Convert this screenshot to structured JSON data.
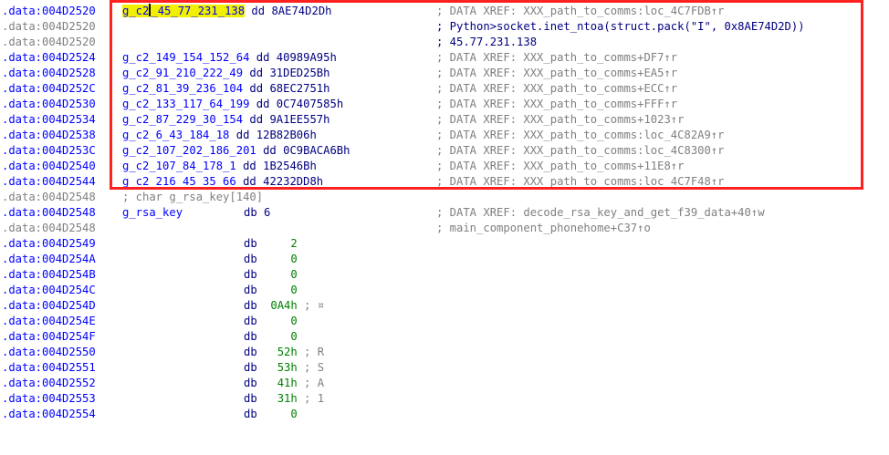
{
  "highlight_color": "#ff2020",
  "lines": [
    {
      "addr": ".data:004D2520",
      "name_hl": "g_c2",
      "name": "_45_77_231_138",
      "dir": "dd",
      "val": "8AE74D2Dh",
      "comment": "; DATA XREF: XXX_path_to_comms:loc_4C7FDB↑r"
    },
    {
      "addr": ".data:004D2520",
      "comment": "; Python>socket.inet_ntoa(struct.pack(\"I\", 0x8AE74D2D))"
    },
    {
      "addr": ".data:004D2520",
      "comment": "; 45.77.231.138"
    },
    {
      "addr": ".data:004D2524",
      "name": "g_c2_149_154_152_64",
      "dir": "dd",
      "val": "40989A95h",
      "comment": "; DATA XREF: XXX_path_to_comms+DF7↑r"
    },
    {
      "addr": ".data:004D2528",
      "name": "g_c2_91_210_222_49",
      "dir": "dd",
      "val": "31DED25Bh",
      "comment": "; DATA XREF: XXX_path_to_comms+EA5↑r"
    },
    {
      "addr": ".data:004D252C",
      "name": "g_c2_81_39_236_104",
      "dir": "dd",
      "val": "68EC2751h",
      "comment": "; DATA XREF: XXX_path_to_comms+ECC↑r"
    },
    {
      "addr": ".data:004D2530",
      "name": "g_c2_133_117_64_199",
      "dir": "dd",
      "val": "0C7407585h",
      "comment": "; DATA XREF: XXX_path_to_comms+FFF↑r"
    },
    {
      "addr": ".data:004D2534",
      "name": "g_c2_87_229_30_154",
      "dir": "dd",
      "val": "9A1EE557h",
      "comment": "; DATA XREF: XXX_path_to_comms+1023↑r"
    },
    {
      "addr": ".data:004D2538",
      "name": "g_c2_6_43_184_18",
      "dir": "dd",
      "val": "12B82B06h",
      "comment": "; DATA XREF: XXX_path_to_comms:loc_4C82A9↑r"
    },
    {
      "addr": ".data:004D253C",
      "name": "g_c2_107_202_186_201",
      "dir": "dd",
      "val": "0C9BACA6Bh",
      "comment": "; DATA XREF: XXX_path_to_comms:loc_4C8300↑r"
    },
    {
      "addr": ".data:004D2540",
      "name": "g_c2_107_84_178_1",
      "dir": "dd",
      "val": "1B2546Bh",
      "comment": "; DATA XREF: XXX_path_to_comms+11E8↑r"
    },
    {
      "addr": ".data:004D2544",
      "name": "g_c2_216_45_35_66",
      "dir": "dd",
      "val": "42232DD8h",
      "comment": "; DATA XREF: XXX_path_to_comms:loc_4C7F48↑r"
    },
    {
      "addr": ".data:004D2548",
      "struct": "; char g_rsa_key[140]"
    },
    {
      "addr": ".data:004D2548",
      "name": "g_rsa_key",
      "dir": "db",
      "val": "6",
      "comment": "; DATA XREF: decode_rsa_key_and_get_f39_data+40↑w"
    },
    {
      "addr": ".data:004D2548",
      "comment": "; main_component_phonehome+C37↑o"
    },
    {
      "addr": ".data:004D2549",
      "dir": "db",
      "val": "2"
    },
    {
      "addr": ".data:004D254A",
      "dir": "db",
      "val": "0"
    },
    {
      "addr": ".data:004D254B",
      "dir": "db",
      "val": "0"
    },
    {
      "addr": ".data:004D254C",
      "dir": "db",
      "val": "0"
    },
    {
      "addr": ".data:004D254D",
      "dir": "db",
      "val": "0A4h",
      "cmt": "; ¤"
    },
    {
      "addr": ".data:004D254E",
      "dir": "db",
      "val": "0"
    },
    {
      "addr": ".data:004D254F",
      "dir": "db",
      "val": "0"
    },
    {
      "addr": ".data:004D2550",
      "dir": "db",
      "val": "52h",
      "cmt": "; R"
    },
    {
      "addr": ".data:004D2551",
      "dir": "db",
      "val": "53h",
      "cmt": "; S"
    },
    {
      "addr": ".data:004D2552",
      "dir": "db",
      "val": "41h",
      "cmt": "; A"
    },
    {
      "addr": ".data:004D2553",
      "dir": "db",
      "val": "31h",
      "cmt": "; 1"
    },
    {
      "addr": ".data:004D2554",
      "dir": "db",
      "val": "0"
    }
  ]
}
